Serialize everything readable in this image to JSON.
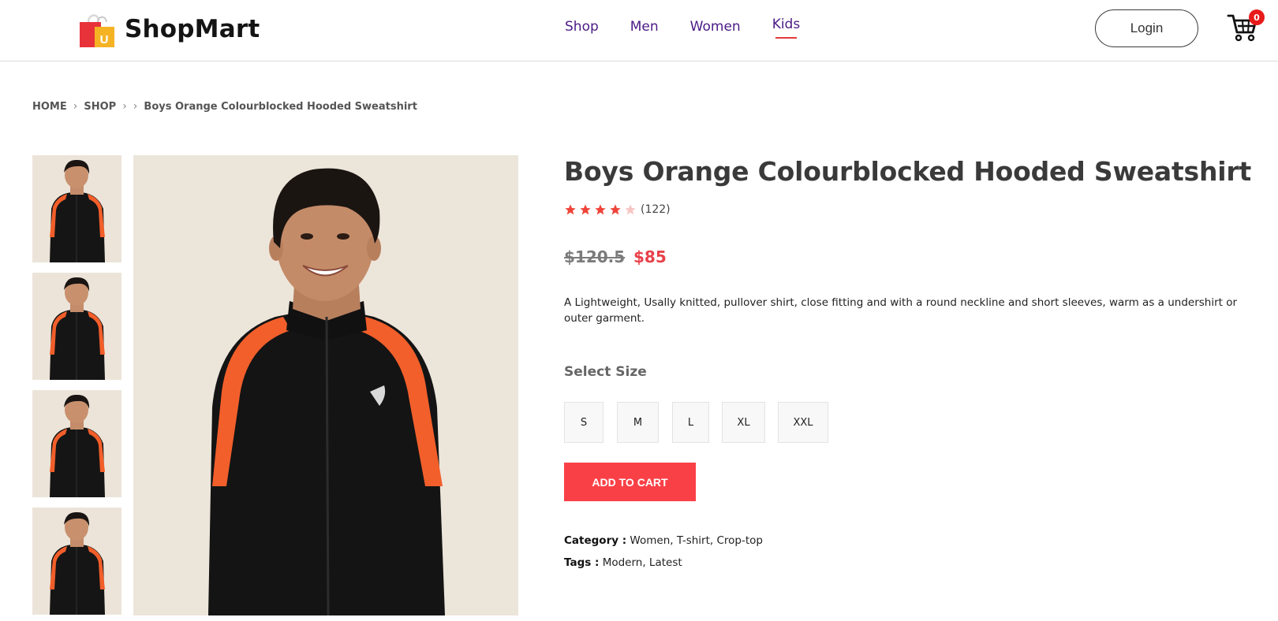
{
  "brand": {
    "name": "ShopMart",
    "logo_letter": "U"
  },
  "nav": [
    "Shop",
    "Men",
    "Women",
    "Kids"
  ],
  "nav_active": "Kids",
  "header": {
    "login_label": "Login",
    "cart_count": "0"
  },
  "breadcrumb": {
    "home": "HOME",
    "shop": "SHOP",
    "current": "Boys Orange Colourblocked Hooded Sweatshirt"
  },
  "product": {
    "title": "Boys Orange Colourblocked Hooded Sweatshirt",
    "rating": 4,
    "rating_max": 5,
    "rating_count": "(122)",
    "price_old": "$120.5",
    "price_new": "$85",
    "description": "A Lightweight, Usally knitted, pullover shirt, close fitting and with a round neckline and short sleeves, warm as a undershirt or outer garment.",
    "select_size_label": "Select Size",
    "sizes": [
      "S",
      "M",
      "L",
      "XL",
      "XXL"
    ],
    "add_to_cart_label": "ADD TO CART",
    "category_label": "Category :",
    "category_value": "Women, T-shirt, Crop-top",
    "tags_label": "Tags :",
    "tags_value": "Modern, Latest"
  },
  "colors": {
    "nav": "#4b1a86",
    "accent": "#fa4047",
    "price_new": "#e8414a",
    "star": "#f0443a",
    "star_empty": "#f7c6c3",
    "image_bg": "#ece5da"
  }
}
